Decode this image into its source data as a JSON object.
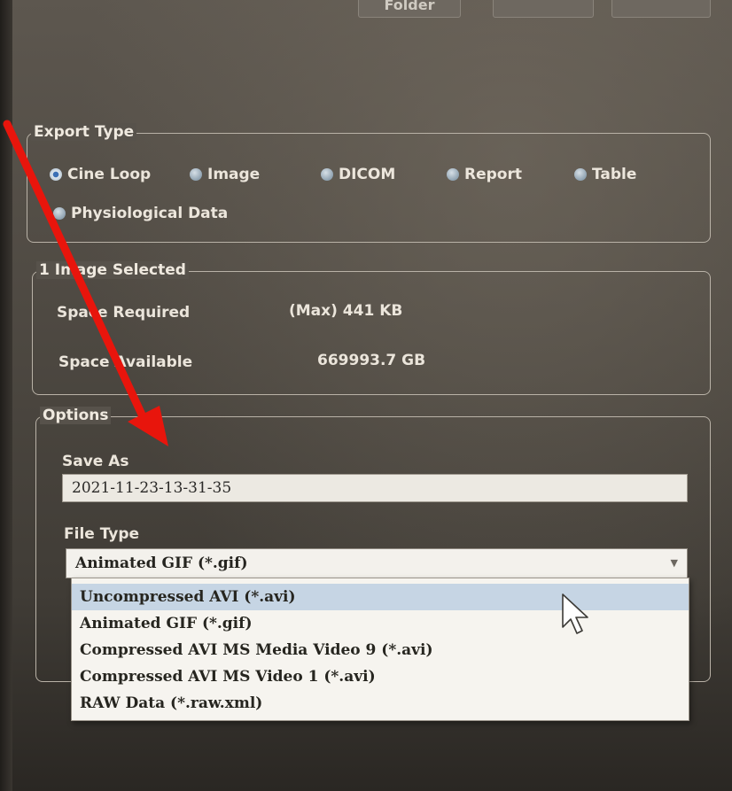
{
  "top_buttons": {
    "folder_label": "Folder",
    "button_2_label": "",
    "button_3_label": ""
  },
  "export_type": {
    "legend": "Export Type",
    "options": [
      {
        "label": "Cine Loop",
        "checked": true
      },
      {
        "label": "Image",
        "checked": false
      },
      {
        "label": "DICOM",
        "checked": false
      },
      {
        "label": "Report",
        "checked": false
      },
      {
        "label": "Table",
        "checked": false
      },
      {
        "label": "Physiological Data",
        "checked": false
      }
    ]
  },
  "selection": {
    "legend": "1 Image Selected",
    "space_required_label": "Space Required",
    "space_required_value": "(Max) 441 KB",
    "space_available_label": "Space Available",
    "space_available_value": "669993.7 GB"
  },
  "options": {
    "legend": "Options",
    "save_as_label": "Save As",
    "save_as_value": "2021-11-23-13-31-35",
    "file_type_label": "File Type",
    "file_type_selected": "Animated GIF (*.gif)",
    "file_type_options": [
      "Uncompressed AVI (*.avi)",
      "Animated GIF (*.gif)",
      "Compressed AVI MS Media Video 9 (*.avi)",
      "Compressed AVI MS Video 1 (*.avi)",
      "RAW Data (*.raw.xml)"
    ],
    "hovered_index": 0
  },
  "colors": {
    "annotation_arrow": "#e8150c",
    "hover_highlight": "#c6d5e4",
    "radio_selected": "#3a6fb5"
  }
}
